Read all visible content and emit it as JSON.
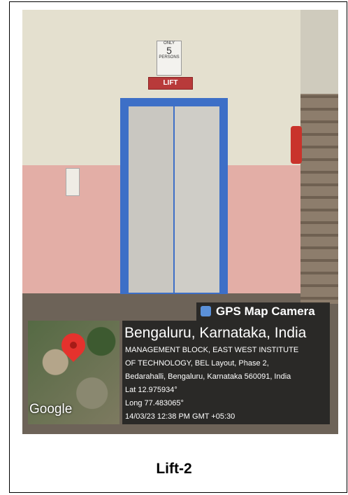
{
  "photo": {
    "notice": {
      "top": "ONLY",
      "number": "5",
      "bottom": "PERSONS"
    },
    "lift_sign": "LIFT"
  },
  "overlay": {
    "app_name": "GPS Map Camera",
    "map_watermark": "Google",
    "city": "Bengaluru, Karnataka, India",
    "address_lines": [
      "MANAGEMENT BLOCK, EAST WEST INSTITUTE",
      "OF TECHNOLOGY, BEL Layout, Phase 2,",
      "Bedarahalli, Bengaluru, Karnataka 560091, India"
    ],
    "lat": "Lat 12.975934°",
    "long": "Long 77.483065°",
    "timestamp": "14/03/23 12:38 PM GMT +05:30"
  },
  "caption": "Lift-2"
}
